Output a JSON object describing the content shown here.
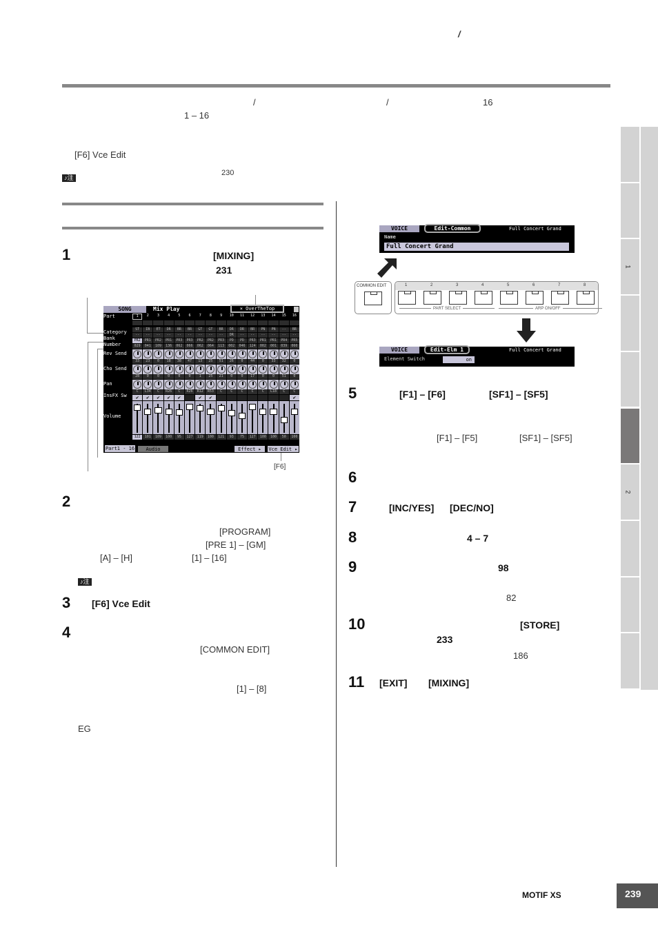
{
  "header": {
    "slash": "/"
  },
  "intro": {
    "line1": {
      "slash1": "/",
      "slash2": "/",
      "count": "16"
    },
    "line2": {
      "range": "1 – 16"
    },
    "f6_label": "[F6] Vce Edit",
    "note_badge": "♪注",
    "note_page": "230"
  },
  "left": {
    "step1": {
      "num": "1",
      "button": "[MIXING]",
      "page": "231"
    },
    "mix_screen": {
      "mode": "SONG",
      "title": "Mix Play",
      "song_name": "× OverTheTop",
      "row_labels": {
        "part": "Part",
        "category": "Category",
        "bank": "Bank",
        "number": "Number",
        "rev": "Rev Send",
        "cho": "Cho Send",
        "pan": "Pan",
        "insfx": "InsFX Sw",
        "volume": "Volume"
      },
      "parts": [
        "1",
        "2",
        "3",
        "4",
        "5",
        "6",
        "7",
        "8",
        "9",
        "10",
        "11",
        "12",
        "13",
        "14",
        "15",
        "16"
      ],
      "category_main": [
        "ST",
        "IB",
        "ET",
        "DR",
        "BR",
        "BR",
        "GT",
        "GT",
        "BR",
        "DR",
        "DR",
        "BR",
        "PN",
        "PN",
        "--",
        "BR"
      ],
      "category_sub": [
        "--",
        "--",
        "--",
        "--",
        "--",
        "--",
        "--",
        "--",
        "--",
        "DR",
        "--",
        "--",
        "--",
        "--",
        "--",
        "--"
      ],
      "bank": [
        "PR2",
        "PR1",
        "PR2",
        "PR1",
        "PR3",
        "PR3",
        "PR2",
        "PR2",
        "PR3",
        "PD",
        "PD",
        "PR3",
        "PR1",
        "PR1",
        "PR4",
        "PR5"
      ],
      "number": [
        "029",
        "041",
        "109",
        "136",
        "062",
        "066",
        "062",
        "064",
        "113",
        "002",
        "046",
        "124",
        "002",
        "001",
        "039",
        "060"
      ],
      "rev_send": [
        "33",
        "23",
        "0",
        "18",
        "38",
        "47",
        "13",
        "25",
        "51",
        "26",
        "0",
        "44",
        "0",
        "33",
        "32",
        "0"
      ],
      "cho_send": [
        "28",
        "0",
        "0",
        "0",
        "0",
        "0",
        "1",
        "25",
        "21",
        "0",
        "0",
        "17",
        "0",
        "0",
        "51",
        "0"
      ],
      "pan": [
        "C",
        "L34",
        "C",
        "R26",
        "C",
        "R26",
        "R12",
        "R53",
        "C",
        "C",
        "C",
        "C",
        "C",
        "L18",
        "C",
        "C"
      ],
      "insfx_sw": [
        true,
        true,
        true,
        true,
        true,
        false,
        true,
        true,
        false,
        false,
        false,
        false,
        false,
        false,
        false,
        true
      ],
      "volume": [
        122,
        101,
        109,
        100,
        95,
        127,
        119,
        100,
        121,
        93,
        75,
        127,
        100,
        100,
        50,
        100
      ],
      "volume_max": 127,
      "tab_parts": "Part1 - 16",
      "tab_audio": "Audio",
      "btn_effect": "Effect ▸",
      "btn_vce_edit": "Vce Edit ▸"
    },
    "f6_callout": "[F6]",
    "step2": {
      "num": "2",
      "program": "[PROGRAM]",
      "banks": "[PRE 1] – [GM]",
      "groups": "[A] – [H]",
      "numbers": "[1] – [16]",
      "note_badge": "♪注"
    },
    "step3": {
      "num": "3",
      "label": "[F6] Vce Edit"
    },
    "step4": {
      "num": "4",
      "common_edit": "[COMMON EDIT]",
      "elements": "[1] – [8]",
      "eg": "EG"
    }
  },
  "right": {
    "voice_common": {
      "mode": "VOICE",
      "tab": "Edit-Common",
      "voice_name": "Full Concert Grand",
      "field_label": "Name",
      "field_value": "Full Concert Grand"
    },
    "panel": {
      "common_edit": "COMMON EDIT",
      "buttons": [
        "1",
        "2",
        "3",
        "4",
        "5",
        "6",
        "7",
        "8"
      ],
      "part_select": "PART SELECT",
      "arp": "ARP ON/OFF"
    },
    "voice_elm": {
      "mode": "VOICE",
      "tab": "Edit-Elm 1",
      "voice_name": "Full Concert Grand",
      "field_label": "Element Switch",
      "field_value": "on"
    },
    "step5": {
      "num": "5",
      "keys1": "[F1] – [F6]",
      "keys2": "[SF1] – [SF5]",
      "keys3": "[F1] – [F5]",
      "keys4": "[SF1] – [SF5]"
    },
    "step6": {
      "num": "6"
    },
    "step7": {
      "num": "7",
      "inc": "[INC/YES]",
      "dec": "[DEC/NO]"
    },
    "step8": {
      "num": "8",
      "range": "4 – 7"
    },
    "step9": {
      "num": "9",
      "page": "98",
      "page2": "82"
    },
    "step10": {
      "num": "10",
      "store": "[STORE]",
      "page": "233",
      "page2": "186"
    },
    "step11": {
      "num": "11",
      "exit": "[EXIT]",
      "mixing": "[MIXING]"
    }
  },
  "sidebar": {
    "tabs": [
      "",
      "",
      "1",
      "",
      "",
      "",
      "2",
      "",
      "",
      ""
    ],
    "active_index": 5
  },
  "footer": {
    "product": "MOTIF XS",
    "page": "239"
  }
}
